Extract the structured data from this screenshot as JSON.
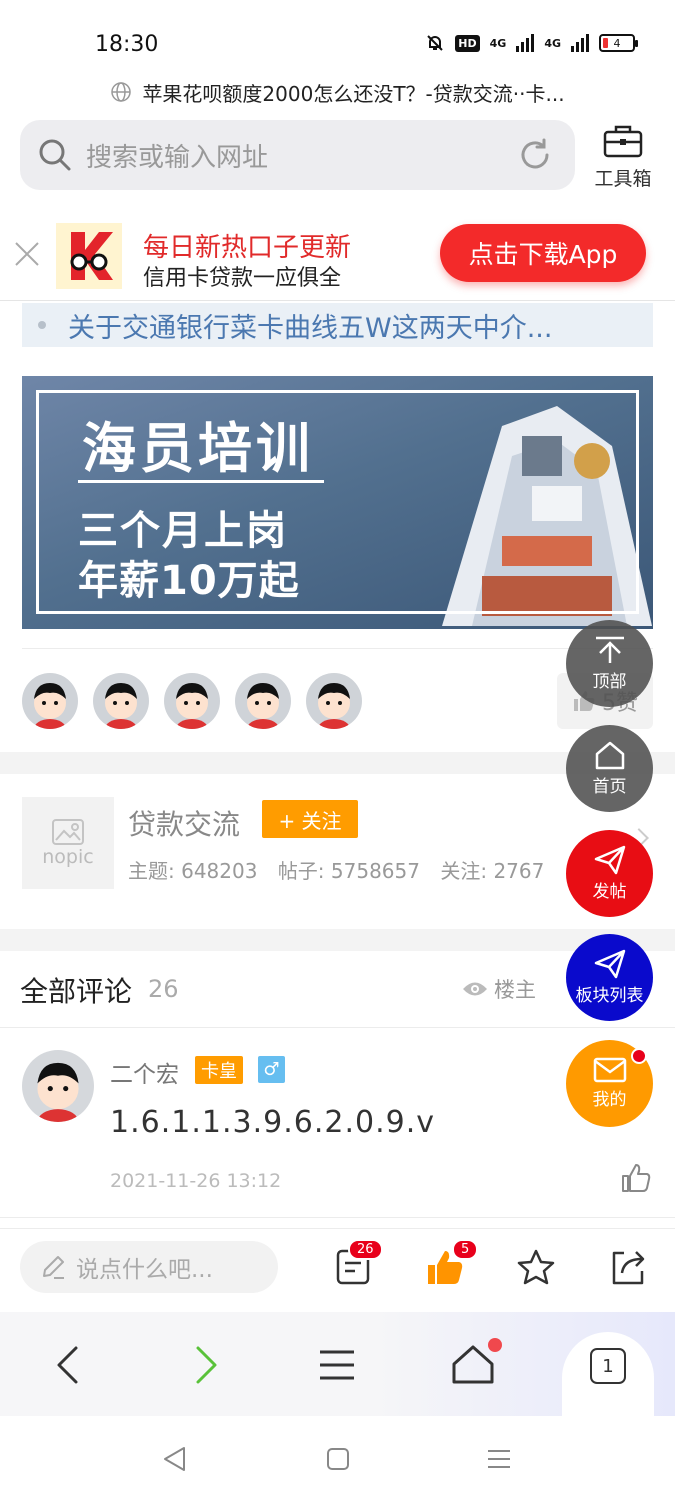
{
  "status_bar": {
    "time": "18:30",
    "network_4g_1": "4G",
    "network_4g_2": "4G",
    "hd_label": "HD",
    "battery": "4"
  },
  "browser": {
    "page_title": "苹果花呗额度2000怎么还没T？-贷款交流··卡...",
    "search_placeholder": "搜索或输入网址",
    "toolbox_label": "工具箱"
  },
  "download_banner": {
    "line1": "每日新热口子更新",
    "line2": "信用卡贷款一应俱全",
    "button": "点击下载App"
  },
  "related_thread": "关于交通银行菜卡曲线五W这两天中介...",
  "ad": {
    "title": "海员培训",
    "line1": "三个月上岗",
    "line2": "年薪10万起"
  },
  "likes": {
    "count_label": "5赞"
  },
  "forum": {
    "logo_text": "nopic",
    "name": "贷款交流",
    "follow_label": "+ 关注",
    "topics": "主题: 648203",
    "posts": "帖子: 5758657",
    "followers": "关注: 2767"
  },
  "comments": {
    "title": "全部评论",
    "count": "26",
    "op_only": "楼主",
    "items": [
      {
        "user": "二个宏",
        "rank": "卡皇",
        "gender": "♂",
        "text": "1.6.1.1.3.9.6.2.0.9.v",
        "time": "2021-11-26 13:12"
      }
    ]
  },
  "floating": {
    "top": "顶部",
    "home": "首页",
    "post": "发帖",
    "boards": "板块列表",
    "mine": "我的"
  },
  "action_bar": {
    "reply_placeholder": "说点什么吧...",
    "comment_badge": "26",
    "like_badge": "5"
  },
  "browser_nav": {
    "tab_count": "1"
  },
  "colors": {
    "accent_red": "#f32a2a",
    "orange": "#ff9c00",
    "link_blue": "#4b78b0",
    "boards_blue": "#0a0acc"
  }
}
